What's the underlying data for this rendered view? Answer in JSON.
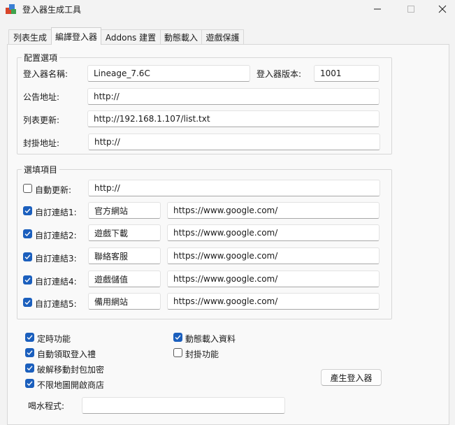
{
  "window": {
    "title": "登入器生成工具"
  },
  "tabs": [
    {
      "label": "列表生成"
    },
    {
      "label": "編譯登入器"
    },
    {
      "label": "Addons 建置"
    },
    {
      "label": "動態載入"
    },
    {
      "label": "遊戲保護"
    }
  ],
  "active_tab": "編譯登入器",
  "config": {
    "legend": "配置選項",
    "launcher_name_label": "登入器名稱:",
    "launcher_name_value": "Lineage_7.6C",
    "version_label": "登入器版本:",
    "version_value": "1001",
    "notice_label": "公告地址:",
    "notice_value": "http://",
    "list_update_label": "列表更新:",
    "list_update_value": "http://192.168.1.107/list.txt",
    "ban_label": "封掛地址:",
    "ban_value": "http://"
  },
  "options": {
    "legend": "選填項目",
    "auto_update": {
      "label": "自動更新:",
      "checked": false,
      "value": "http://"
    },
    "links": [
      {
        "label": "自訂連結1:",
        "checked": true,
        "name": "官方網站",
        "url": "https://www.google.com/"
      },
      {
        "label": "自訂連結2:",
        "checked": true,
        "name": "遊戲下載",
        "url": "https://www.google.com/"
      },
      {
        "label": "自訂連結3:",
        "checked": true,
        "name": "聯絡客服",
        "url": "https://www.google.com/"
      },
      {
        "label": "自訂連結4:",
        "checked": true,
        "name": "遊戲儲值",
        "url": "https://www.google.com/"
      },
      {
        "label": "自訂連結5:",
        "checked": true,
        "name": "備用網站",
        "url": "https://www.google.com/"
      }
    ]
  },
  "features": {
    "timer": {
      "label": "定時功能",
      "checked": true
    },
    "dynamic_load": {
      "label": "動態載入資料",
      "checked": true
    },
    "auto_gift": {
      "label": "自動領取登入禮",
      "checked": true
    },
    "ban_feature": {
      "label": "封掛功能",
      "checked": false
    },
    "crack_encrypt": {
      "label": "破解移動封包加密",
      "checked": true
    },
    "unlimited_shop": {
      "label": "不限地圖開啟商店",
      "checked": true
    }
  },
  "generate_button": "產生登入器",
  "water_program_label": "喝水程式:",
  "water_program_value": ""
}
